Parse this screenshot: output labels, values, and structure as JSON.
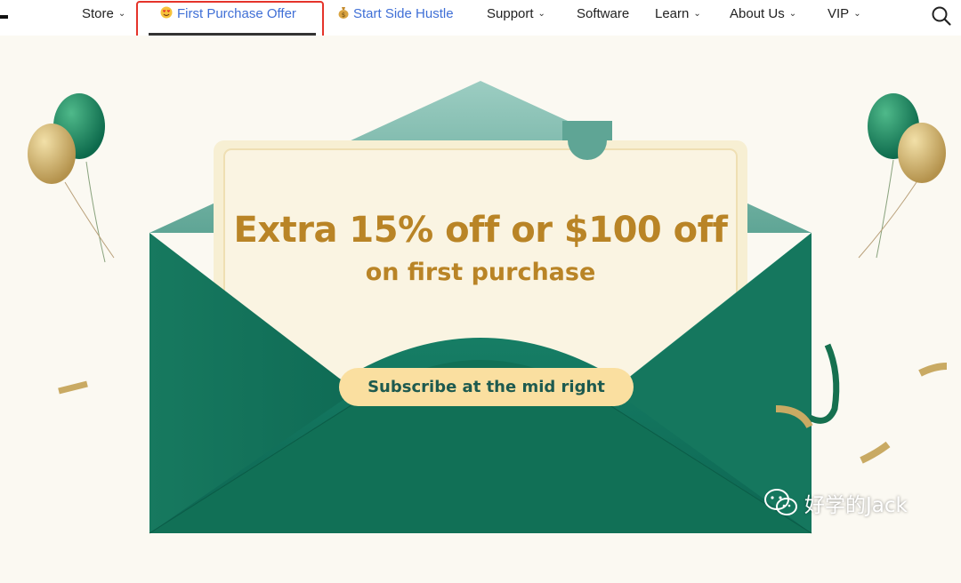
{
  "nav": {
    "items": [
      {
        "label": "Store",
        "chevron": true
      },
      {
        "label": "First Purchase Offer",
        "icon": "heart-eyes-emoji",
        "active": true
      },
      {
        "label": "Start Side Hustle",
        "icon": "money-bag-emoji"
      },
      {
        "label": "Support",
        "chevron": true
      },
      {
        "label": "Software",
        "chevron": false
      },
      {
        "label": "Learn",
        "chevron": true
      },
      {
        "label": "About Us",
        "chevron": true
      },
      {
        "label": "VIP",
        "chevron": true
      }
    ],
    "search_icon": "search-icon",
    "chevron_glyph": "⌄"
  },
  "hero": {
    "headline": "Extra 15% off or $100 off",
    "subline": "on first purchase",
    "cta_label": "Subscribe at the mid right"
  },
  "watermark": {
    "text": "好学的Jack",
    "icon": "wechat-icon"
  },
  "colors": {
    "background": "#fbf9f2",
    "promo_link": "#3f6fd6",
    "envelope_green": "#13725d",
    "headline_gold": "#b98426",
    "cta_fill": "#fadfa0",
    "cta_text": "#1d5a4f",
    "highlight_border": "#e5342a"
  }
}
